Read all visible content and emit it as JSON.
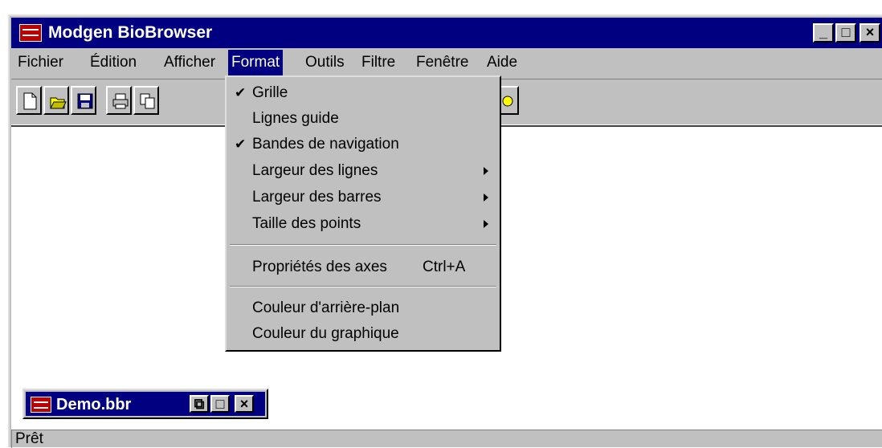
{
  "app": {
    "title": "Modgen BioBrowser",
    "window_buttons": {
      "minimize": "_",
      "maximize": "□",
      "close": "×"
    }
  },
  "menu": [
    {
      "label": "Fichier",
      "active": false
    },
    {
      "label": "Édition",
      "active": false
    },
    {
      "label": "Afficher",
      "active": false
    },
    {
      "label": "Format",
      "active": true
    },
    {
      "label": "Outils",
      "active": false
    },
    {
      "label": "Filtre",
      "active": false
    },
    {
      "label": "Fenêtre",
      "active": false
    },
    {
      "label": "Aide",
      "active": false
    }
  ],
  "toolbar": {
    "buttons": [
      "new-file-icon",
      "open-folder-icon",
      "save-icon",
      "print-icon",
      "copy-icon",
      "extra-tool-icon"
    ]
  },
  "format_menu": {
    "items": [
      {
        "label": "Grille",
        "checked": true,
        "submenu": false,
        "shortcut": ""
      },
      {
        "label": "Lignes guide",
        "checked": false,
        "submenu": false,
        "shortcut": ""
      },
      {
        "label": "Bandes de navigation",
        "checked": true,
        "submenu": false,
        "shortcut": ""
      },
      {
        "label": "Largeur des lignes",
        "checked": false,
        "submenu": true,
        "shortcut": ""
      },
      {
        "label": "Largeur des barres",
        "checked": false,
        "submenu": true,
        "shortcut": ""
      },
      {
        "label": "Taille des points",
        "checked": false,
        "submenu": true,
        "shortcut": ""
      },
      {
        "label": "Propriétés des axes",
        "checked": false,
        "submenu": false,
        "shortcut": "Ctrl+A"
      },
      {
        "label": "Couleur d'arrière-plan",
        "checked": false,
        "submenu": false,
        "shortcut": ""
      },
      {
        "label": "Couleur du graphique",
        "checked": false,
        "submenu": false,
        "shortcut": ""
      }
    ]
  },
  "minimized_window": {
    "title": "Demo.bbr",
    "buttons": {
      "restore": "⧉",
      "maximize": "□",
      "close": "×"
    }
  },
  "status": {
    "text": "Prêt"
  },
  "colors": {
    "titlebar": "#000080",
    "face": "#c0c0c0",
    "workspace": "#ffffff"
  }
}
